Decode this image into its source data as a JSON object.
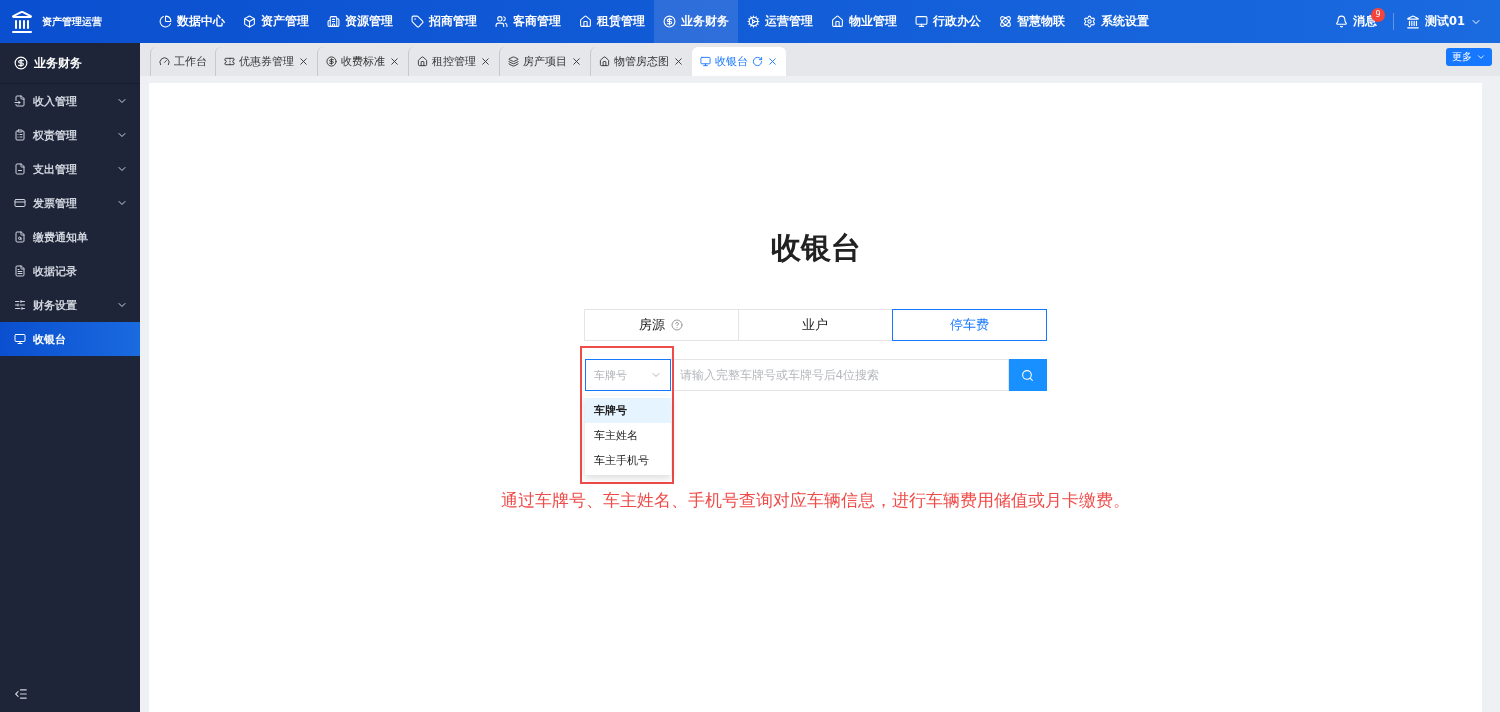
{
  "app": {
    "title": "资产管理运营"
  },
  "top_nav": [
    {
      "label": "数据中心",
      "selected": false
    },
    {
      "label": "资产管理",
      "selected": false
    },
    {
      "label": "资源管理",
      "selected": false
    },
    {
      "label": "招商管理",
      "selected": false
    },
    {
      "label": "客商管理",
      "selected": false
    },
    {
      "label": "租赁管理",
      "selected": false
    },
    {
      "label": "业务财务",
      "selected": true
    },
    {
      "label": "运营管理",
      "selected": false
    },
    {
      "label": "物业管理",
      "selected": false
    },
    {
      "label": "行政办公",
      "selected": false
    },
    {
      "label": "智慧物联",
      "selected": false
    },
    {
      "label": "系统设置",
      "selected": false
    }
  ],
  "messages": {
    "label": "消息",
    "badge": "9"
  },
  "user": {
    "name": "测试01"
  },
  "sidebar": {
    "title": "业务财务",
    "items": [
      {
        "label": "收入管理",
        "expandable": true,
        "selected": false
      },
      {
        "label": "权责管理",
        "expandable": true,
        "selected": false
      },
      {
        "label": "支出管理",
        "expandable": true,
        "selected": false
      },
      {
        "label": "发票管理",
        "expandable": true,
        "selected": false
      },
      {
        "label": "缴费通知单",
        "expandable": false,
        "selected": false
      },
      {
        "label": "收据记录",
        "expandable": false,
        "selected": false
      },
      {
        "label": "财务设置",
        "expandable": true,
        "selected": false
      },
      {
        "label": "收银台",
        "expandable": false,
        "selected": true
      }
    ]
  },
  "page_tabs": [
    {
      "label": "工作台",
      "closable": false,
      "selected": false
    },
    {
      "label": "优惠券管理",
      "closable": true,
      "selected": false
    },
    {
      "label": "收费标准",
      "closable": true,
      "selected": false
    },
    {
      "label": "租控管理",
      "closable": true,
      "selected": false
    },
    {
      "label": "房产项目",
      "closable": true,
      "selected": false
    },
    {
      "label": "物管房态图",
      "closable": true,
      "selected": false
    },
    {
      "label": "收银台",
      "closable": true,
      "selected": true
    }
  ],
  "more_button": {
    "label": "更多"
  },
  "cashier": {
    "title": "收银台",
    "modes": [
      {
        "label": "房源",
        "help": true,
        "selected": false
      },
      {
        "label": "业户",
        "help": false,
        "selected": false
      },
      {
        "label": "停车费",
        "help": false,
        "selected": true
      }
    ],
    "search_type": {
      "placeholder": "车牌号",
      "options": [
        {
          "label": "车牌号",
          "selected": true
        },
        {
          "label": "车主姓名",
          "selected": false
        },
        {
          "label": "车主手机号",
          "selected": false
        }
      ]
    },
    "search": {
      "placeholder": "请输入完整车牌号或车牌号后4位搜索"
    },
    "note": "通过车牌号、车主姓名、手机号查询对应车辆信息，进行车辆费用储值或月卡缴费。"
  }
}
